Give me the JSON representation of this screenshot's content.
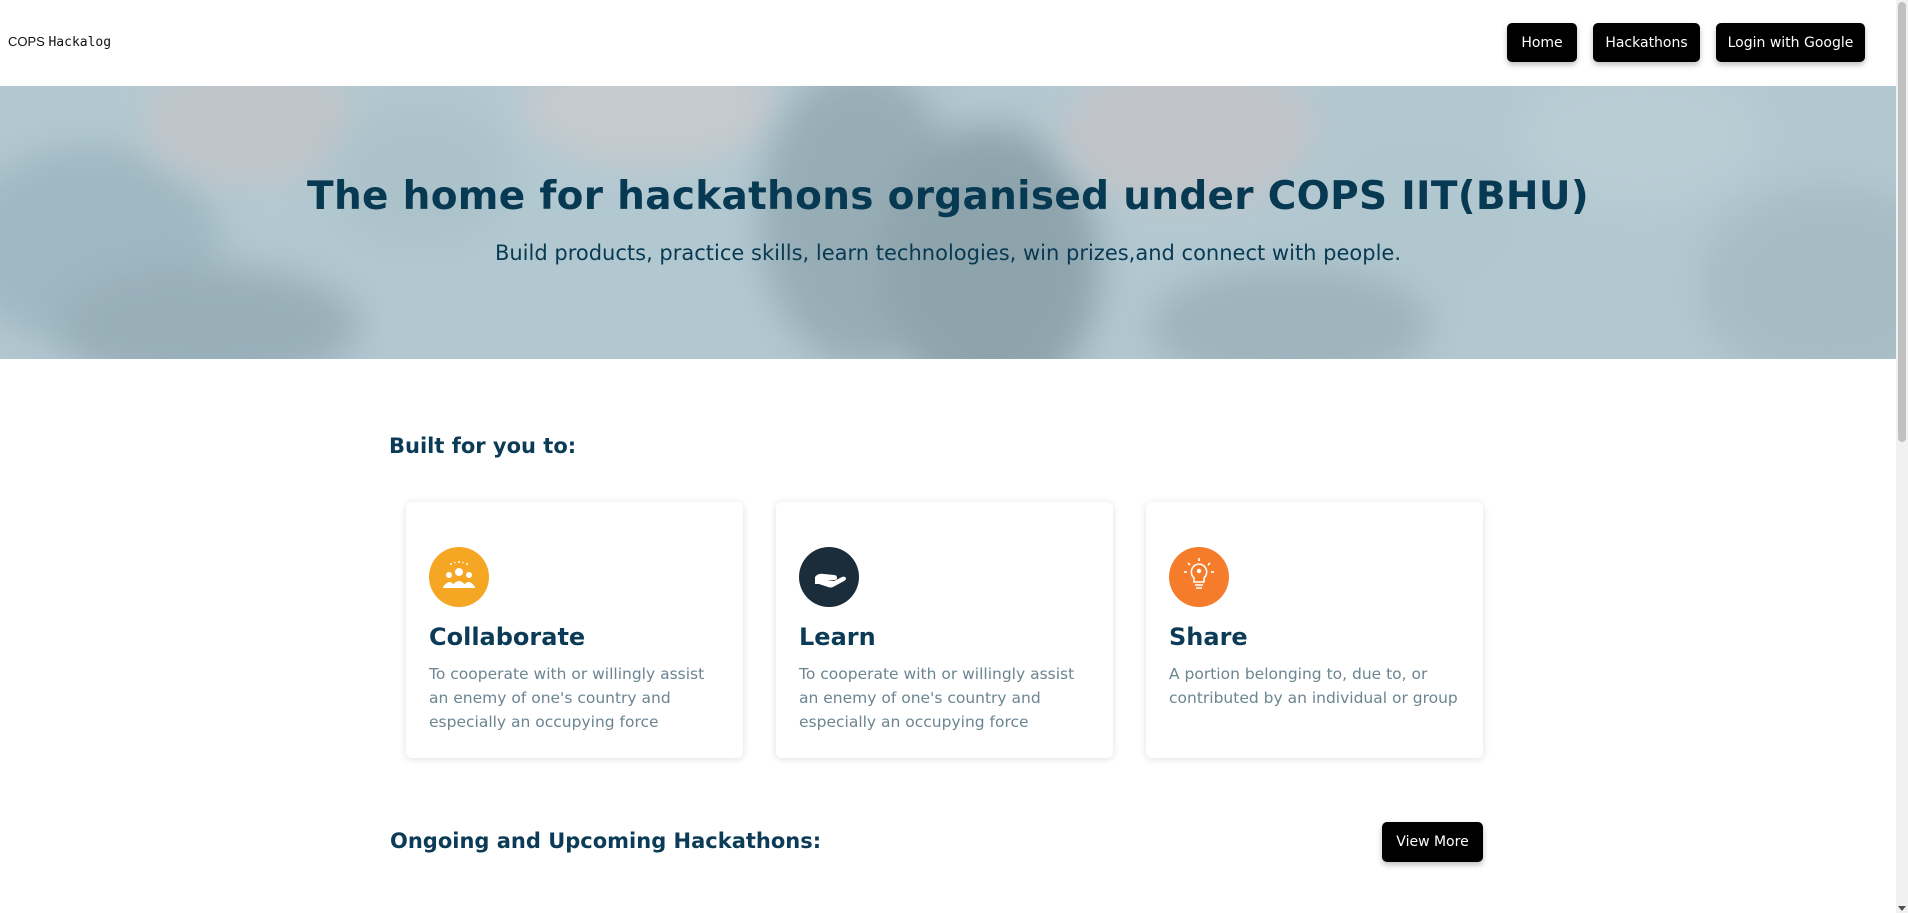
{
  "header": {
    "brand_prefix": "COPS",
    "brand_suffix": "Hackalog",
    "nav": {
      "home": "Home",
      "hackathons": "Hackathons",
      "login": "Login with Google"
    }
  },
  "hero": {
    "title": "The home for hackathons organised under COPS IIT(BHU)",
    "subtitle": "Build products, practice skills, learn technologies, win prizes,and connect with people."
  },
  "built": {
    "title": "Built for you to:",
    "cards": [
      {
        "title": "Collaborate",
        "text": "To cooperate with or willingly assist an enemy of one's country and especially an occupying force",
        "icon": "team-icon",
        "icon_color": "#f5a623"
      },
      {
        "title": "Learn",
        "text": "To cooperate with or willingly assist an enemy of one's country and especially an occupying force",
        "icon": "hand-icon",
        "icon_color": "#1b2d3b"
      },
      {
        "title": "Share",
        "text": "A portion belonging to, due to, or contributed by an individual or group",
        "icon": "lightbulb-icon",
        "icon_color": "#f57c2b"
      }
    ]
  },
  "ongoing": {
    "title": "Ongoing and Upcoming Hackathons:",
    "view_more": "View More"
  }
}
